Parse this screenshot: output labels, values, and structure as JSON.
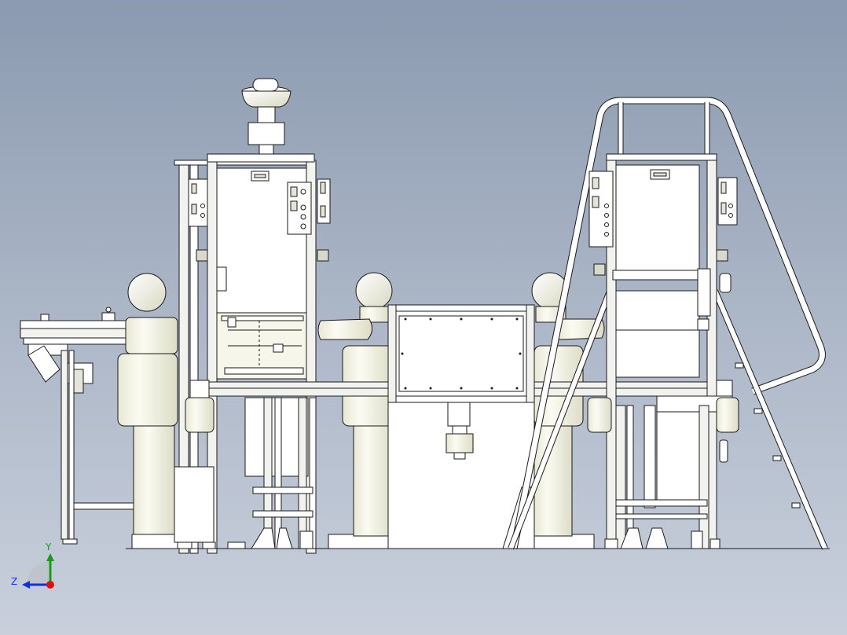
{
  "viewport": {
    "background_top": "#8b9ab0",
    "background_bottom": "#c9d0dc"
  },
  "colors": {
    "line": "#1a1a1a",
    "body_fill": "#f6f6ea",
    "panel_fill": "#ffffff",
    "rail_fill": "#f2f2ee",
    "axis_x": "#e01010",
    "axis_y": "#10a010",
    "axis_z": "#1030e0"
  },
  "triad": {
    "x_label": "",
    "y_label": "Y",
    "z_label": "Z"
  }
}
